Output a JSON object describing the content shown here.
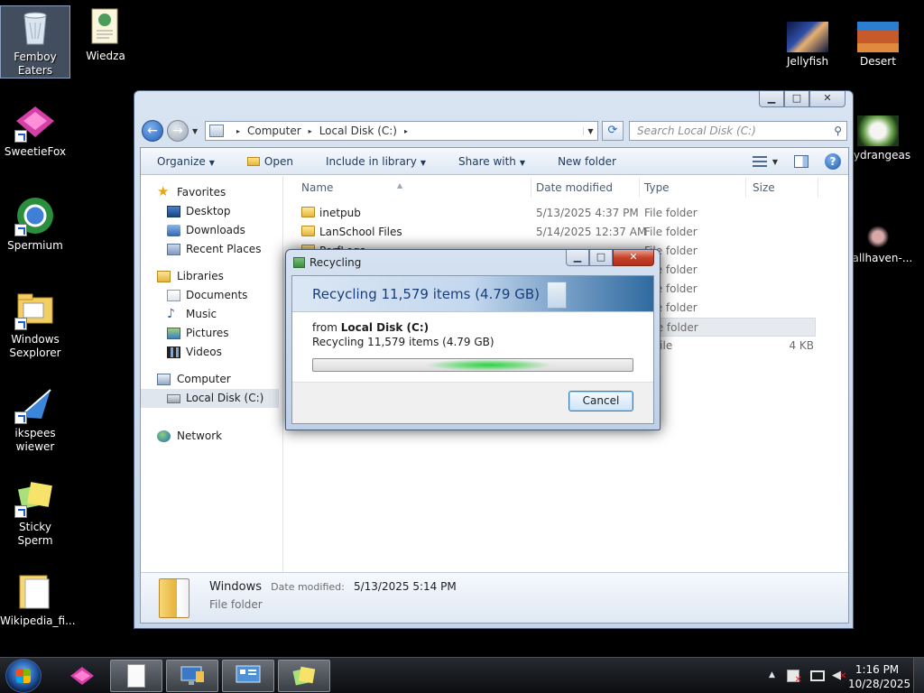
{
  "desktop": {
    "icons_left": [
      {
        "label": "Femboy Eaters",
        "icon": "recycle-bin-icon",
        "selected": true
      },
      {
        "label": "Wiedza",
        "icon": "document-icon"
      },
      {
        "label": "SweetieFox",
        "icon": "sweetiefox-icon"
      },
      {
        "label": "Spermium",
        "icon": "browser-icon"
      },
      {
        "label": "Windows Sexplorer",
        "icon": "explorer-icon"
      },
      {
        "label": "ikspees wiewer",
        "icon": "xps-viewer-icon"
      },
      {
        "label": "Sticky Sperm",
        "icon": "sticky-notes-icon"
      },
      {
        "label": "Wikipedia_fi...",
        "icon": "folder-icon"
      }
    ],
    "icons_right": [
      {
        "label": "Jellyfish",
        "icon": "image-icon"
      },
      {
        "label": "Desert",
        "icon": "image-icon"
      },
      {
        "label": "Hydrangeas",
        "icon": "image-icon"
      },
      {
        "label": "wallhaven-...",
        "icon": "image-icon"
      }
    ]
  },
  "explorer": {
    "caption_buttons": {
      "minimize": "▁",
      "maximize": "□",
      "close": "✕"
    },
    "nav": {
      "back": "←",
      "forward": "→",
      "dropdown": "▼"
    },
    "address": {
      "crumbs": [
        "Computer",
        "Local Disk (C:)"
      ],
      "separator": "▸",
      "drop": "▼"
    },
    "refresh": "⟳",
    "search_placeholder": "Search Local Disk (C:)",
    "search_icon": "⚲",
    "toolbar": {
      "organize": "Organize",
      "open": "Open",
      "include": "Include in library",
      "share": "Share with",
      "new_folder": "New folder",
      "arrow": "▼",
      "help": "?"
    },
    "nav_pane": {
      "favorites": "Favorites",
      "desktop": "Desktop",
      "downloads": "Downloads",
      "recent": "Recent Places",
      "libraries": "Libraries",
      "documents": "Documents",
      "music": "Music",
      "pictures": "Pictures",
      "videos": "Videos",
      "computer": "Computer",
      "local_disk": "Local Disk (C:)",
      "network": "Network"
    },
    "columns": {
      "name": "Name",
      "date": "Date modified",
      "type": "Type",
      "size": "Size",
      "sort_mark": "▲"
    },
    "files": [
      {
        "name": "inetpub",
        "date": "5/13/2025 4:37 PM",
        "type": "File folder",
        "size": ""
      },
      {
        "name": "LanSchool Files",
        "date": "5/14/2025 12:37 AM",
        "type": "File folder",
        "size": ""
      },
      {
        "name": "PerfLogs",
        "date": "",
        "type": "File folder",
        "size": ""
      },
      {
        "name": "",
        "date": "",
        "type": "File folder",
        "size": ""
      },
      {
        "name": "",
        "date": "",
        "type": "File folder",
        "size": ""
      },
      {
        "name": "",
        "date": "",
        "type": "File folder",
        "size": ""
      },
      {
        "name": "",
        "date": "",
        "type": "File folder",
        "size": ""
      },
      {
        "name": "",
        "date": "",
        "type": "T File",
        "size": "4 KB"
      }
    ],
    "details": {
      "name": "Windows",
      "date_label": "Date modified:",
      "date_value": "5/13/2025 5:14 PM",
      "type": "File folder"
    }
  },
  "dialog": {
    "title": "Recycling",
    "caption_buttons": {
      "minimize": "▁",
      "maximize": "□",
      "close": "✕"
    },
    "heading": "Recycling 11,579 items (4.79 GB)",
    "from_label": "from",
    "from_value": "Local Disk (C:)",
    "status": "Recycling 11,579 items (4.79 GB)",
    "cancel": "Cancel",
    "progress": {
      "indeterminate": true,
      "glow_position": 0.55
    }
  },
  "taskbar": {
    "clock_time": "1:16 PM",
    "clock_date": "10/28/2025",
    "tray_arrow": "▲"
  }
}
